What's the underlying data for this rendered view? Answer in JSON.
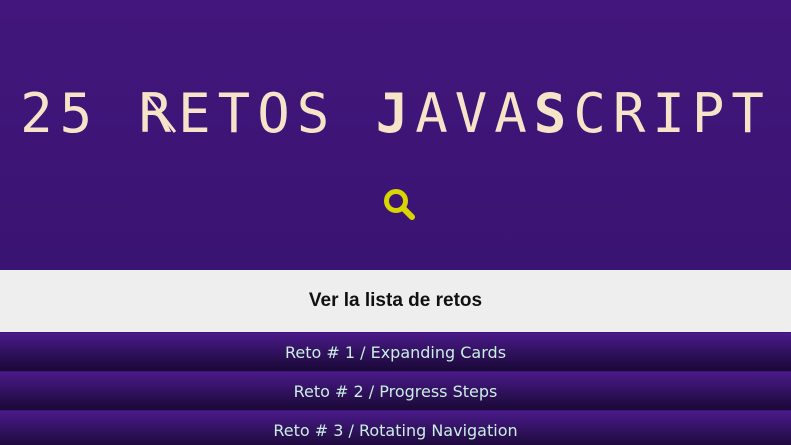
{
  "header": {
    "title_parts": {
      "prefix": "25 ",
      "r_letter": "R",
      "retos_rest": "ETOS ",
      "j": "J",
      "ava": "AVA",
      "s": "S",
      "cript": "CRIPT"
    },
    "search_icon": "magnifier-icon",
    "search_color": "#d8d500"
  },
  "toggle": {
    "label": "Ver la lista de retos"
  },
  "retos": [
    {
      "label": "Reto # 1 / Expanding Cards"
    },
    {
      "label": "Reto # 2 / Progress Steps"
    },
    {
      "label": "Reto # 3 / Rotating Navigation"
    }
  ],
  "colors": {
    "hero_bg": "#42167c",
    "title_color": "#f6e4c8",
    "toggle_bg": "#eeeeee",
    "item_text": "#c9efe2"
  }
}
